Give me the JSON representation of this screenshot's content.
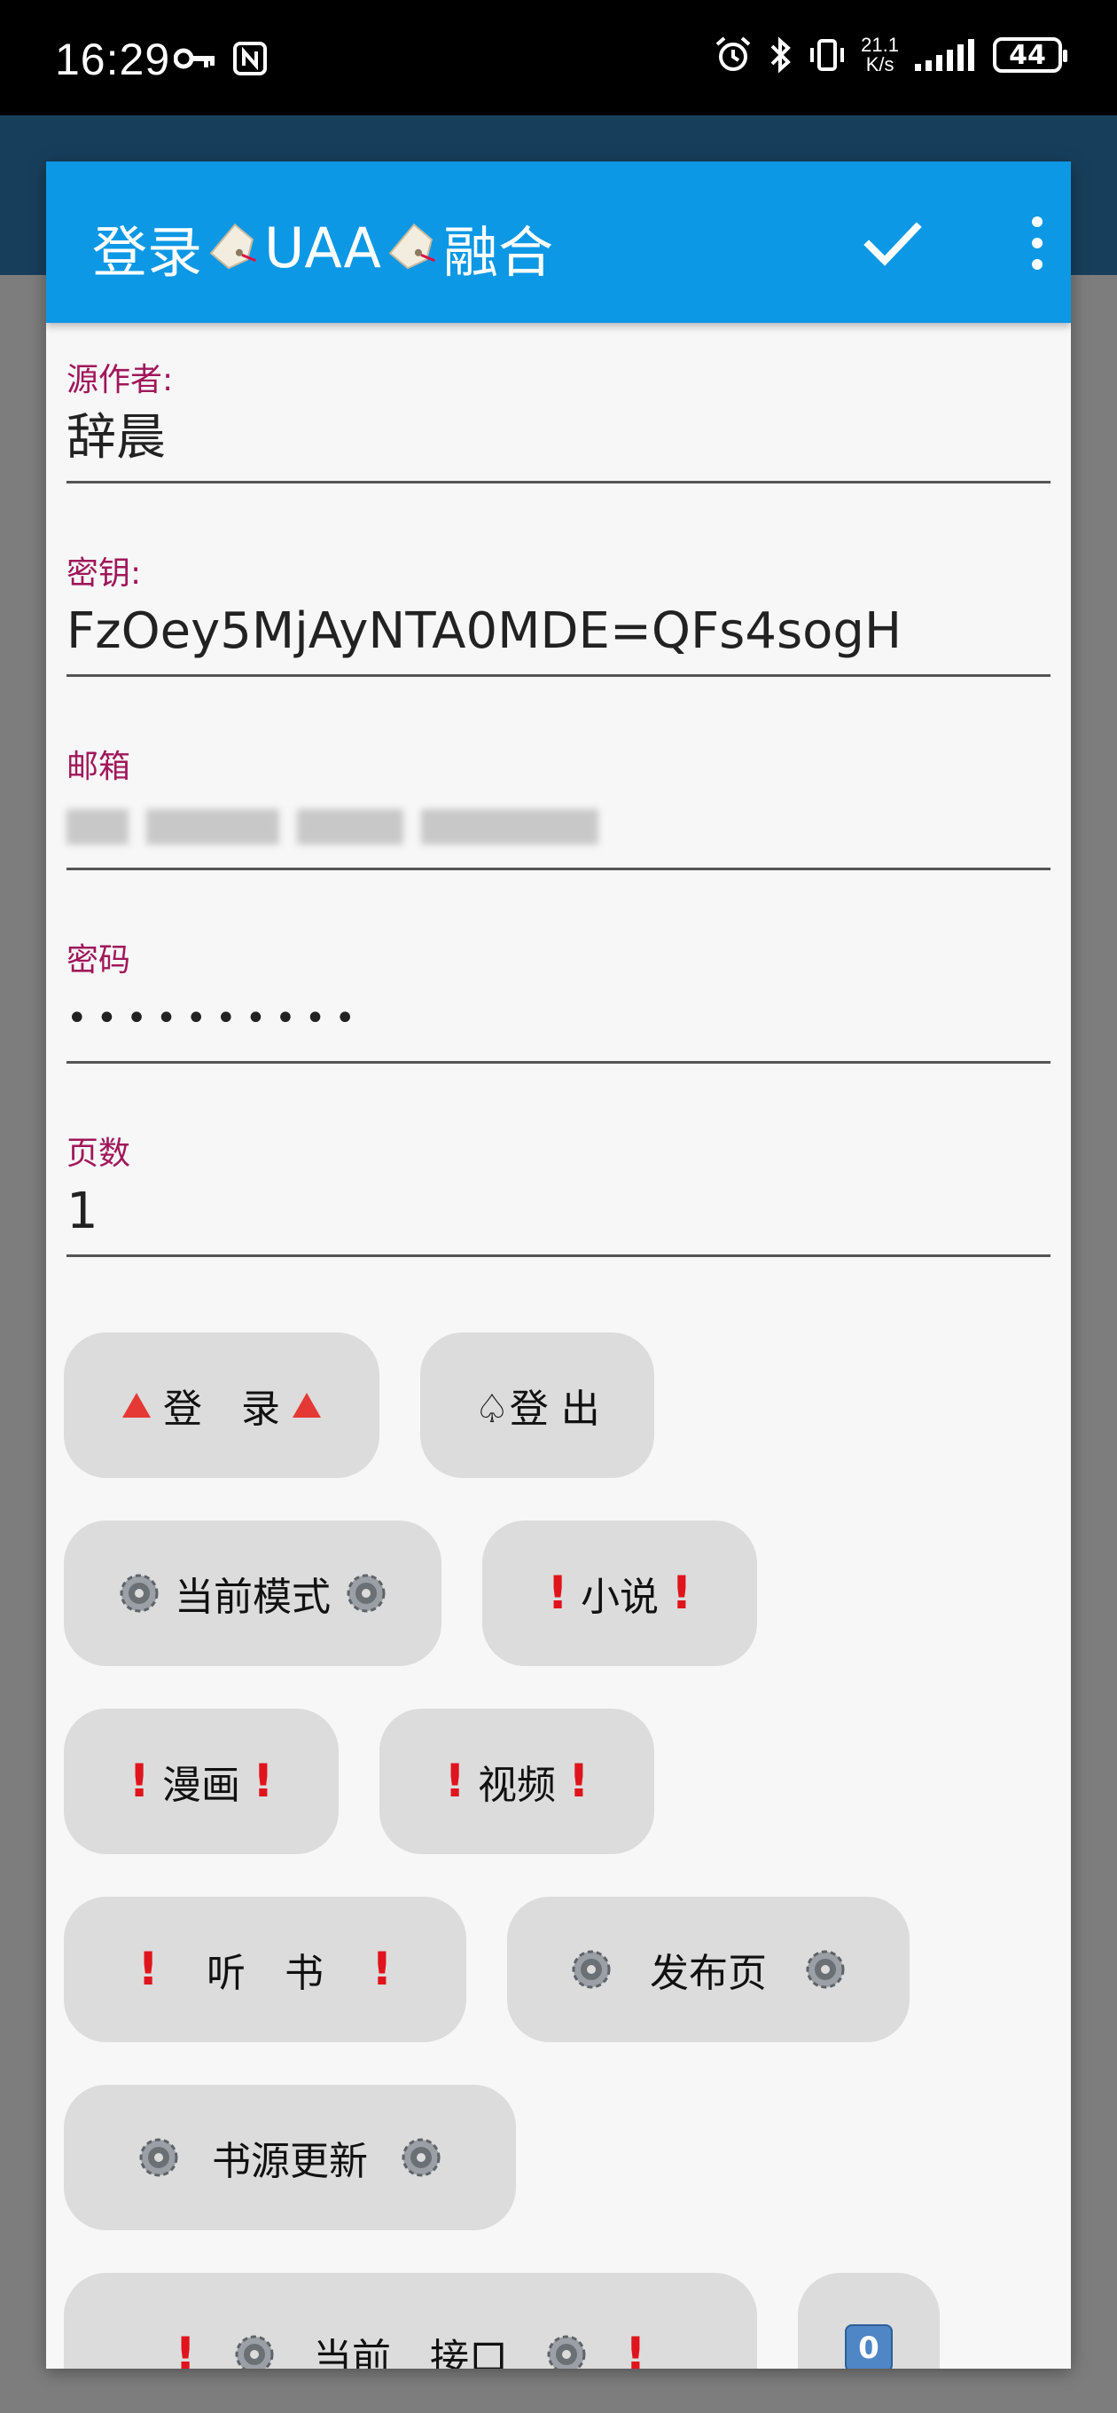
{
  "status_bar": {
    "time": "16:29",
    "net_speed_value": "21.1",
    "net_speed_unit": "K/s",
    "battery": "44",
    "icons": [
      "key-icon",
      "nfc-icon",
      "alarm-icon",
      "bluetooth-icon",
      "vibrate-icon",
      "signal-icon"
    ]
  },
  "dialog": {
    "title_part1": "登录",
    "title_part2": "UAA",
    "title_part3": "融合",
    "actions": [
      "check-icon",
      "more-vert-icon"
    ]
  },
  "fields": {
    "author_label": "源作者:",
    "author_value": "辞晨",
    "key_label": "密钥:",
    "key_value": "FzOey5MjAyNTA0MDE=QFs4sogH",
    "email_label": "邮箱",
    "password_label": "密码",
    "password_value": "••••••••••",
    "pages_label": "页数",
    "pages_value": "1"
  },
  "buttons": {
    "login": "登　录",
    "logout": "♤登 出",
    "current_mode": "当前模式",
    "novel": "小说",
    "comic": "漫画",
    "video": "视频",
    "audiobook": "听　书",
    "publish_page": "发布页",
    "source_update": "书源更新",
    "current_api": "当前　接口",
    "api_badge": "0"
  },
  "colors": {
    "toolbar": "#0d98e5",
    "label": "#a0175a",
    "button_bg": "#dcdcdc"
  }
}
